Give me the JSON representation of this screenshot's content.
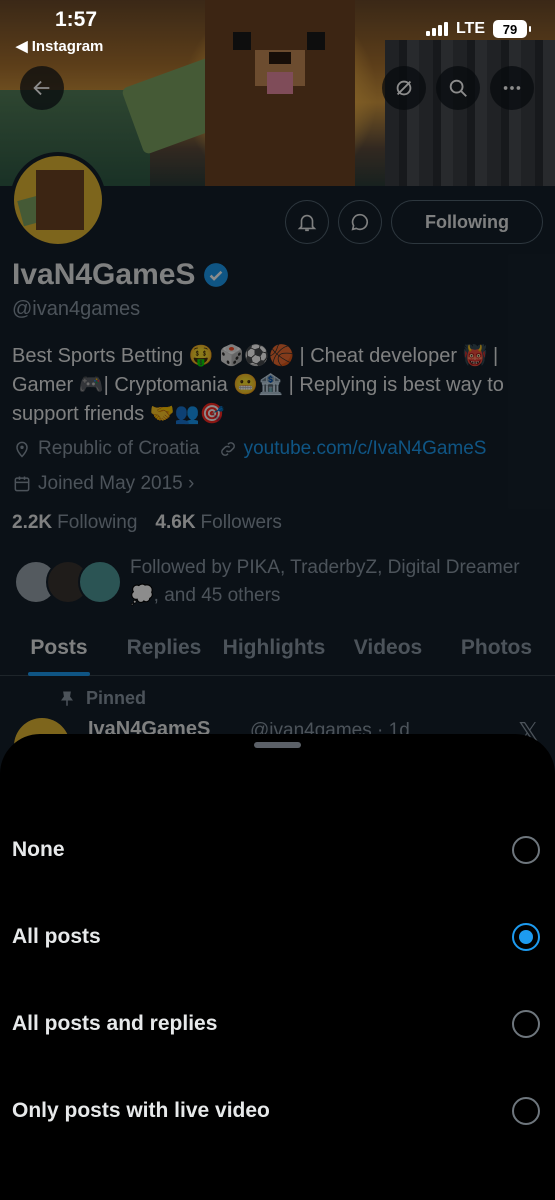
{
  "status_bar": {
    "time": "1:57",
    "back_app": "◀ Instagram",
    "network": "LTE",
    "battery": "79"
  },
  "profile": {
    "name": "IvaN4GameS",
    "handle": "@ivan4games",
    "bio": "Best Sports Betting 🤑 🎲⚽🏀 | Cheat developer 👹 | Gamer 🎮| Cryptomania 😬🏦 | Replying is best way to support friends 🤝👥🎯",
    "location": "Republic of Croatia",
    "website": "youtube.com/c/IvaN4GameS",
    "joined": "Joined May 2015 ›",
    "following_count": "2.2K",
    "following_label": "Following",
    "followers_count": "4.6K",
    "followers_label": "Followers",
    "followed_by": "Followed by PIKA, TraderbyZ, Digital Dreamer 💭, and 45 others",
    "following_button": "Following"
  },
  "tabs": [
    "Posts",
    "Replies",
    "Highlights",
    "Videos",
    "Photos"
  ],
  "pinned_post": {
    "label": "Pinned",
    "author": "IvaN4GameS",
    "meta": "@ivan4games · 1d"
  },
  "sheet": {
    "options": [
      {
        "label": "None",
        "selected": false
      },
      {
        "label": "All posts",
        "selected": true
      },
      {
        "label": "All posts and replies",
        "selected": false
      },
      {
        "label": "Only posts with live video",
        "selected": false
      }
    ]
  },
  "colors": {
    "accent": "#1d9bf0",
    "sheet_bg": "#000000",
    "profile_bg": "#15202b"
  }
}
